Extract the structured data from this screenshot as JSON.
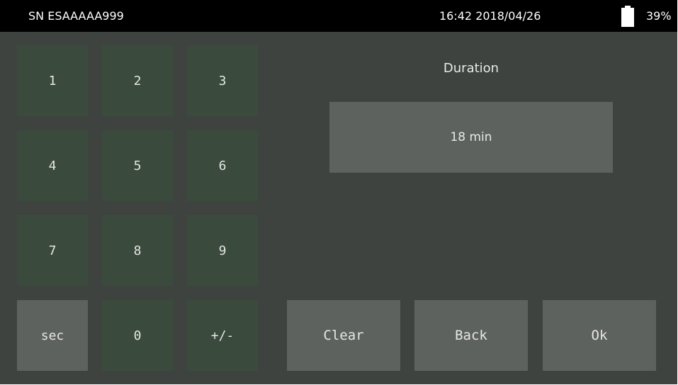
{
  "statusbar": {
    "serial": "SN ESAAAAA999",
    "datetime": "16:42 2018/04/26",
    "battery_percent": "39%",
    "battery_icon": "battery-icon"
  },
  "keypad": {
    "keys": [
      "1",
      "2",
      "3",
      "4",
      "5",
      "6",
      "7",
      "8",
      "9",
      "sec",
      "0",
      "+/-"
    ]
  },
  "field": {
    "label": "Duration",
    "value": "18 min"
  },
  "actions": {
    "clear": "Clear",
    "back": "Back",
    "ok": "Ok"
  },
  "colors": {
    "background": "#3f4340",
    "key": "#3a4a3d",
    "key_light": "#5e625f",
    "statusbar": "#000000"
  }
}
